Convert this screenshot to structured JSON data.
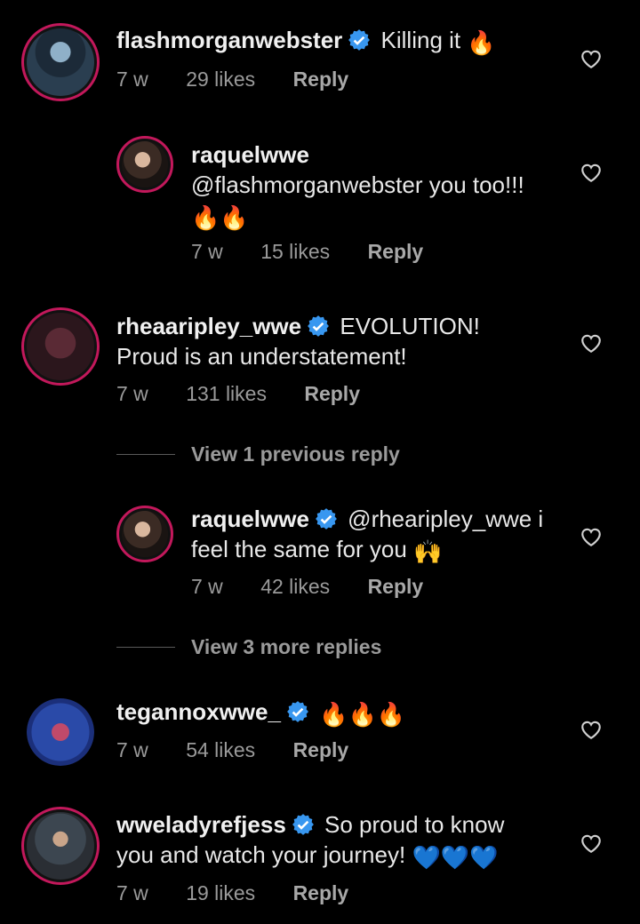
{
  "comments": [
    {
      "username": "flashmorganwebster",
      "verified": true,
      "text": "Killing it",
      "emoji": "🔥",
      "time": "7 w",
      "likes": "29 likes",
      "reply_label": "Reply"
    },
    {
      "username": "raquelwwe",
      "verified": false,
      "text": "@flashmorganwebster you too!!!",
      "emoji": "🔥🔥",
      "time": "7 w",
      "likes": "15 likes",
      "reply_label": "Reply"
    },
    {
      "username": "rheaaripley_wwe",
      "verified": true,
      "text_line1": "EVOLUTION!",
      "text_line2": "Proud is an understatement!",
      "time": "7 w",
      "likes": "131 likes",
      "reply_label": "Reply"
    },
    {
      "username": "raquelwwe",
      "verified": true,
      "text_line1": "@rhearipley_wwe i",
      "text_line2": "feel the same for you",
      "emoji": "🙌",
      "time": "7 w",
      "likes": "42 likes",
      "reply_label": "Reply"
    },
    {
      "username": "tegannoxwwe_",
      "verified": true,
      "emoji": "🔥🔥🔥",
      "time": "7 w",
      "likes": "54 likes",
      "reply_label": "Reply"
    },
    {
      "username": "wweladyrefjess",
      "verified": true,
      "text_line1": "So proud to know",
      "text_line2": "you and watch your journey!",
      "emoji": "💙💙💙",
      "time": "7 w",
      "likes": "19 likes",
      "reply_label": "Reply"
    }
  ],
  "view_previous": "View 1 previous reply",
  "view_more": "View 3 more replies",
  "colors": {
    "background": "#000000",
    "verified": "#3897f0",
    "story_ring": "#c2185b",
    "meta_text": "#9a9a9a"
  }
}
